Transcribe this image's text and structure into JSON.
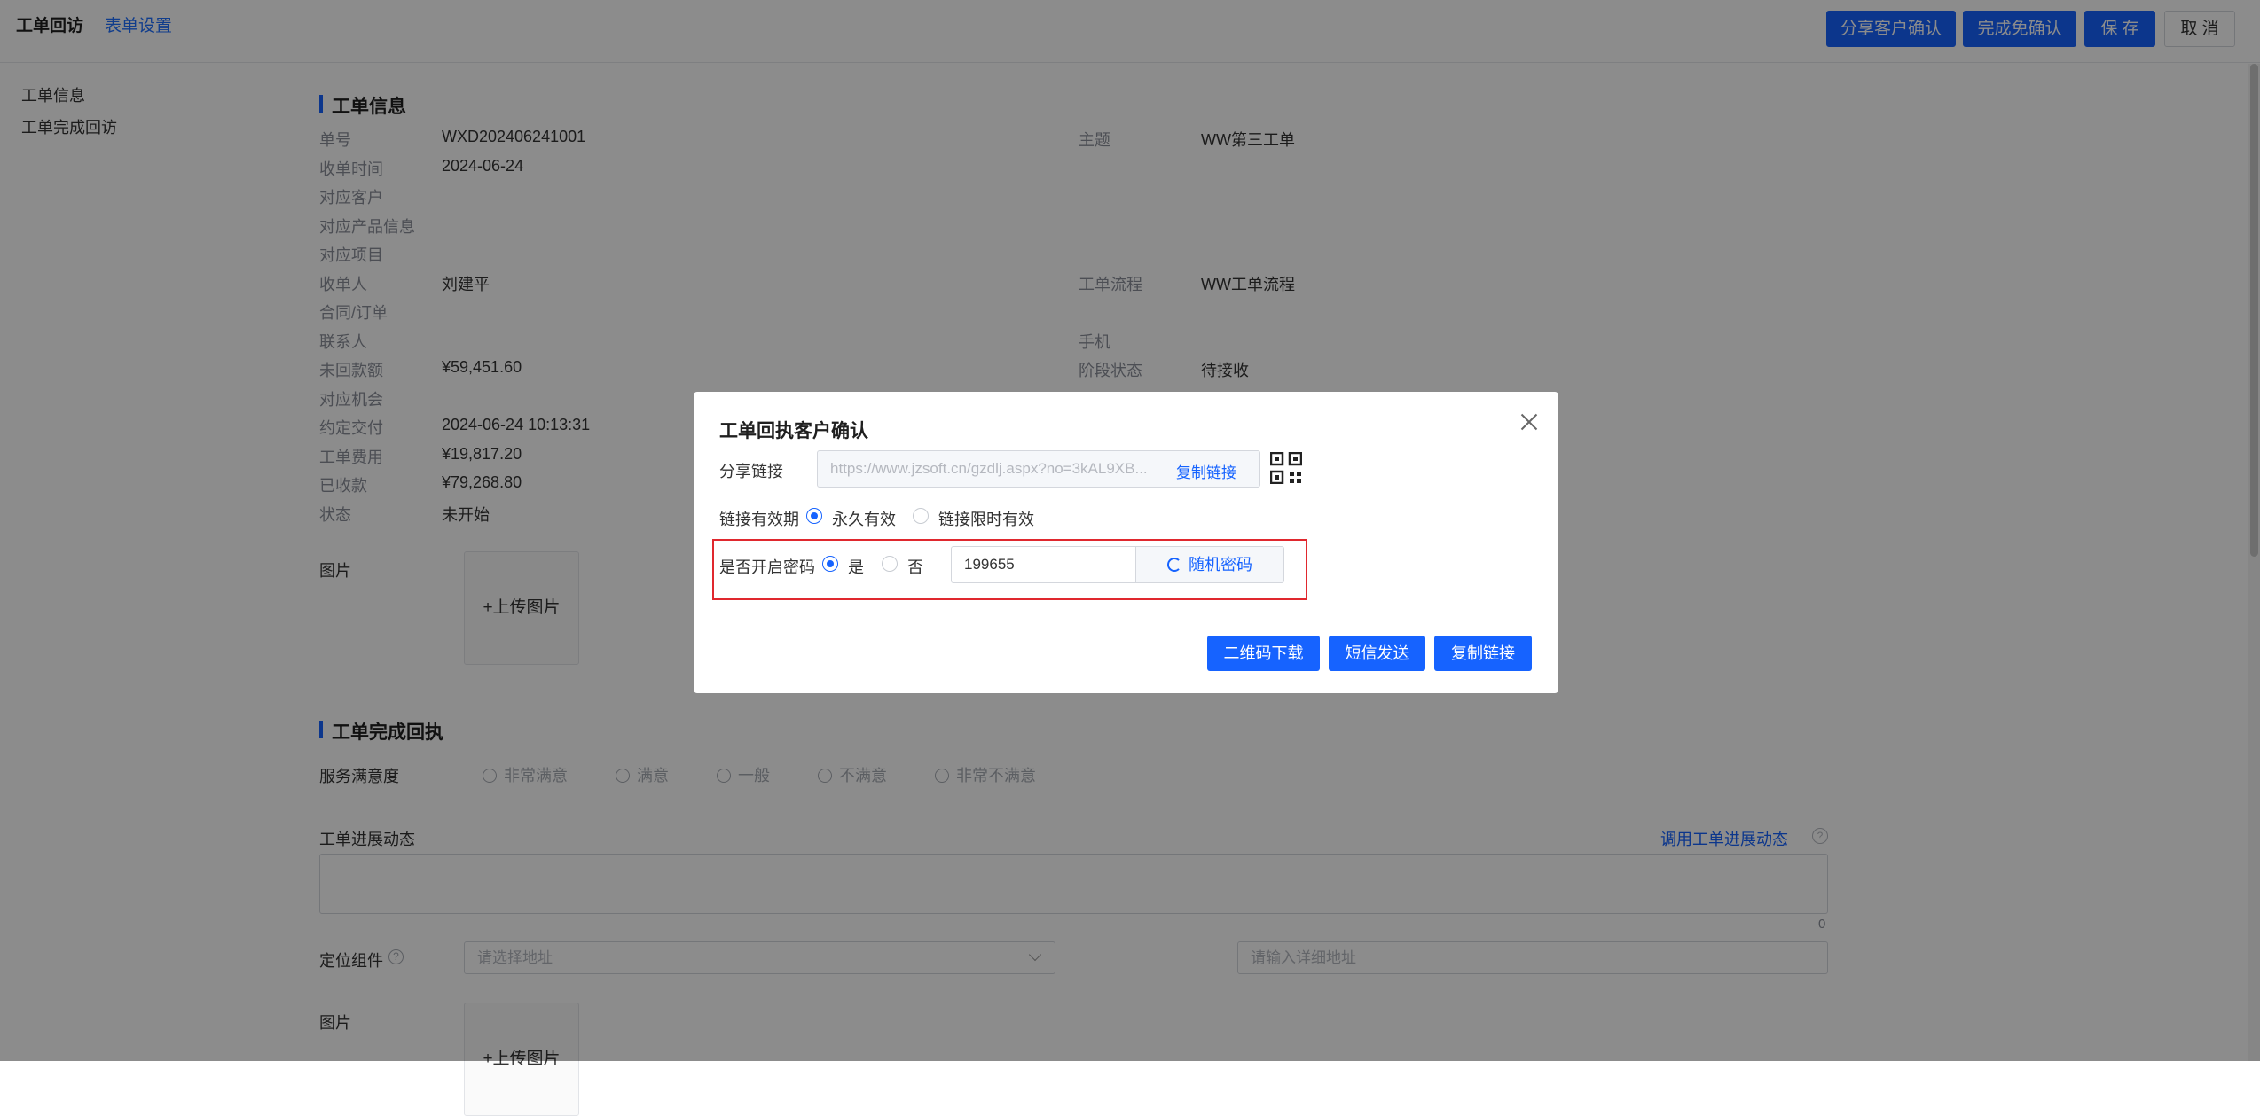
{
  "topbar": {
    "tab_active": "工单回访",
    "tab_link": "表单设置",
    "buttons": [
      "分享客户确认",
      "完成免确认",
      "保 存",
      "取 消"
    ]
  },
  "sidebar": {
    "items": [
      "工单信息",
      "工单完成回访"
    ]
  },
  "order_info": {
    "title": "工单信息",
    "left_fields": [
      {
        "label": "单号",
        "value": "WXD202406241001"
      },
      {
        "label": "收单时间",
        "value": "2024-06-24"
      },
      {
        "label": "对应客户",
        "value": ""
      },
      {
        "label": "对应产品信息",
        "value": ""
      },
      {
        "label": "对应项目",
        "value": ""
      },
      {
        "label": "收单人",
        "value": "刘建平"
      },
      {
        "label": "合同/订单",
        "value": ""
      },
      {
        "label": "联系人",
        "value": ""
      },
      {
        "label": "未回款额",
        "value": "¥59,451.60"
      },
      {
        "label": "对应机会",
        "value": ""
      },
      {
        "label": "约定交付",
        "value": "2024-06-24 10:13:31"
      },
      {
        "label": "工单费用",
        "value": "¥19,817.20"
      },
      {
        "label": "已收款",
        "value": "¥79,268.80"
      },
      {
        "label": "状态",
        "value": "未开始"
      }
    ],
    "right_fields": [
      {
        "label": "主题",
        "value": "WW第三工单"
      },
      {
        "label": "工单流程",
        "value": "WW工单流程"
      },
      {
        "label": "手机",
        "value": ""
      },
      {
        "label": "阶段状态",
        "value": "待接收"
      }
    ],
    "image_label": "图片",
    "upload_label": "+上传图片"
  },
  "completion": {
    "title": "工单完成回执",
    "satisfaction_label": "服务满意度",
    "satisfaction_options": [
      "非常满意",
      "满意",
      "一般",
      "不满意",
      "非常不满意"
    ],
    "progress_label": "工单进展动态",
    "progress_link": "调用工单进展动态",
    "progress_count": "0",
    "location_label": "定位组件",
    "address_placeholder": "请选择地址",
    "detail_placeholder": "请输入详细地址",
    "image_label": "图片",
    "upload_label": "+上传图片"
  },
  "dialog": {
    "title": "工单回执客户确认",
    "share_label": "分享链接",
    "share_url": "https://www.jzsoft.cn/gzdlj.aspx?no=3kAL9XB...",
    "copy_link": "复制链接",
    "validity_label": "链接有效期",
    "validity_options": [
      "永久有效",
      "链接限时有效"
    ],
    "validity_selected": "永久有效",
    "password_label": "是否开启密码",
    "password_options": [
      "是",
      "否"
    ],
    "password_selected": "是",
    "password_value": "199655",
    "random_password": "随机密码",
    "buttons": [
      "二维码下载",
      "短信发送",
      "复制链接"
    ]
  },
  "colors": {
    "primary": "#1663ff",
    "highlight_border": "#e0282e"
  }
}
